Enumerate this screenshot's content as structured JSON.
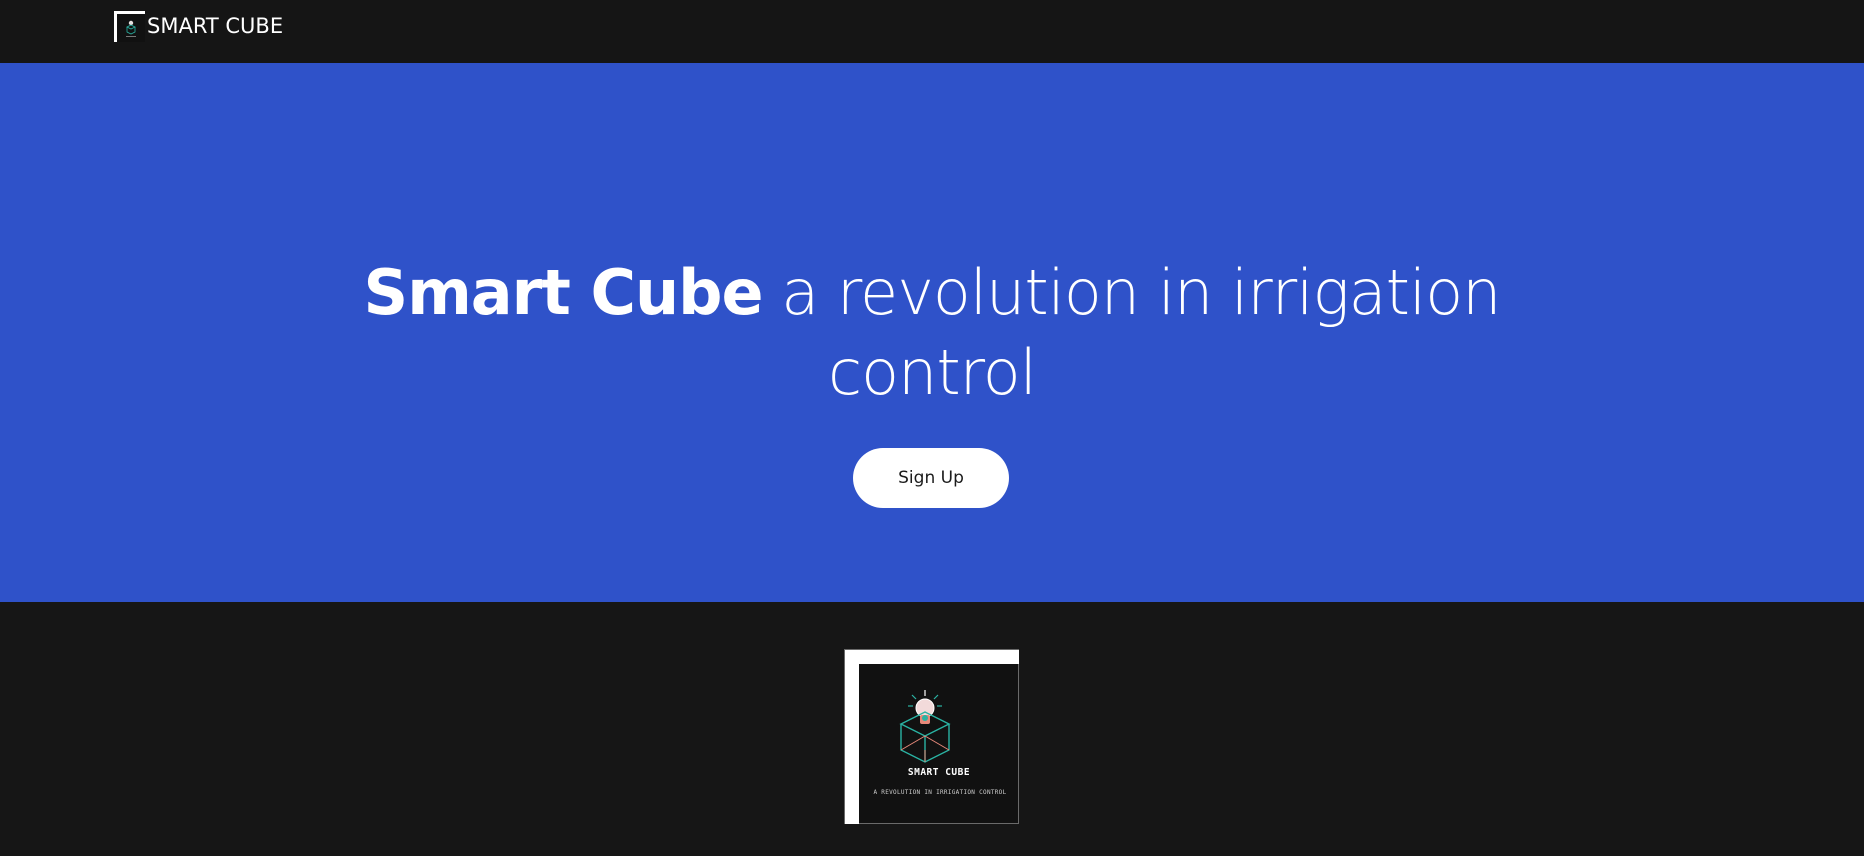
{
  "navbar": {
    "brand_name": "SMART CUBE",
    "logo_icon": "smart-cube-logo"
  },
  "hero": {
    "title_strong": "Smart Cube",
    "title_rest": " a revolution in irrigation control",
    "background_color": "#2f52c9",
    "signup_label": "Sign Up"
  },
  "logo_card": {
    "icon": "lightbulb-cube-icon",
    "title": "SMART CUBE",
    "subtitle": "A REVOLUTION IN IRRIGATION CONTROL",
    "accent_colors": {
      "teal": "#2ab3a3",
      "coral": "#e8897a",
      "bulb": "#f2dada"
    }
  }
}
